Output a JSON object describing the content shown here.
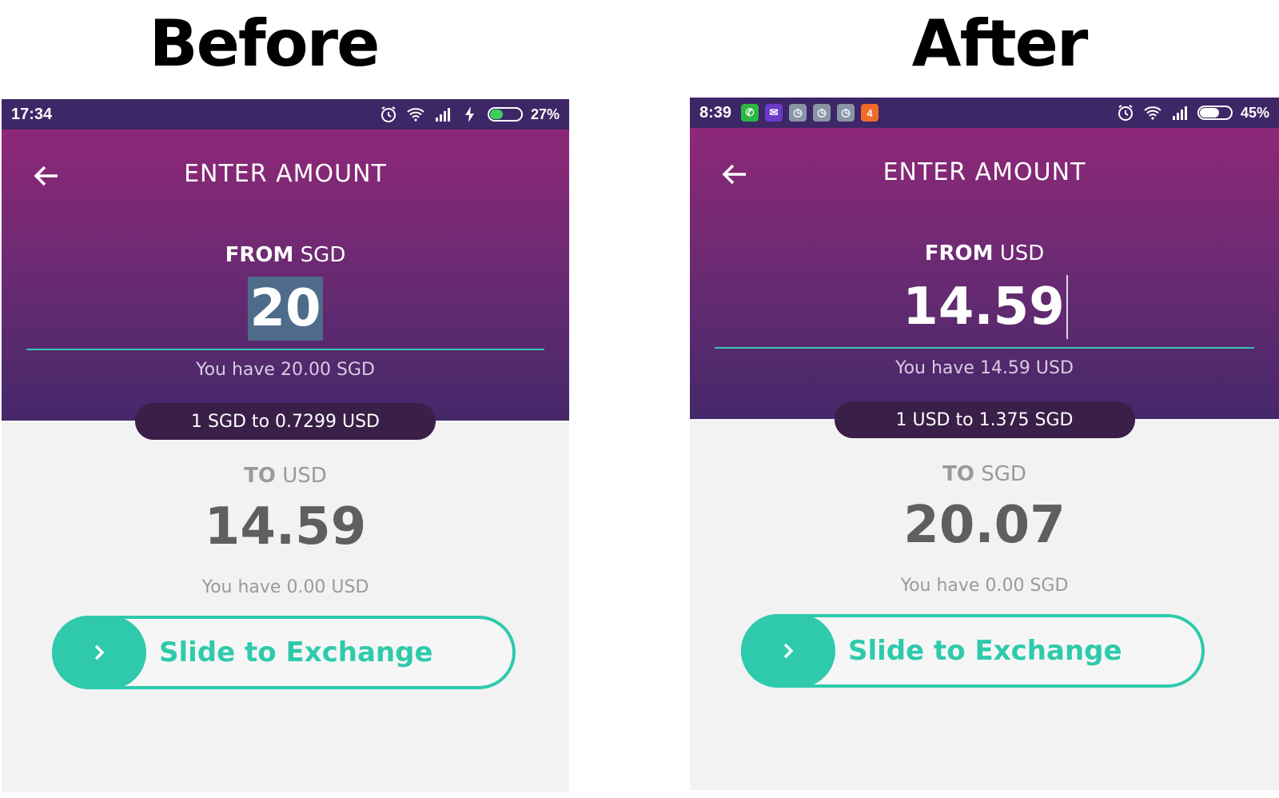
{
  "captions": {
    "before": "Before",
    "after": "After"
  },
  "before": {
    "status": {
      "time": "17:34",
      "battery": "27%",
      "battery_level": 0.27,
      "battery_color": "#3bd05a"
    },
    "header": {
      "title": "ENTER AMOUNT",
      "back_icon": "arrow-left-icon"
    },
    "from": {
      "prefix": "FROM",
      "currency": "SGD",
      "amount": "20",
      "balance": "You have 20.00 SGD"
    },
    "rate": "1 SGD to 0.7299 USD",
    "to": {
      "prefix": "TO",
      "currency": "USD",
      "amount": "14.59",
      "balance": "You have 0.00 USD"
    },
    "slider": {
      "label": "Slide to Exchange",
      "icon": "chevron-right-icon"
    }
  },
  "after": {
    "status": {
      "time": "8:39",
      "battery": "45%",
      "battery_level": 0.45,
      "battery_color": "#ffffff",
      "notification_badge": "4"
    },
    "header": {
      "title": "ENTER AMOUNT",
      "back_icon": "arrow-left-icon"
    },
    "from": {
      "prefix": "FROM",
      "currency": "USD",
      "amount": "14.59",
      "balance": "You have 14.59 USD"
    },
    "rate": "1 USD to 1.375 SGD",
    "to": {
      "prefix": "TO",
      "currency": "SGD",
      "amount": "20.07",
      "balance": "You have 0.00 SGD"
    },
    "slider": {
      "label": "Slide to Exchange",
      "icon": "chevron-right-icon"
    }
  },
  "colors": {
    "accent": "#2ecaab",
    "header_top": "#8e2878",
    "header_bottom": "#45286a",
    "pill": "#3a1f48"
  }
}
